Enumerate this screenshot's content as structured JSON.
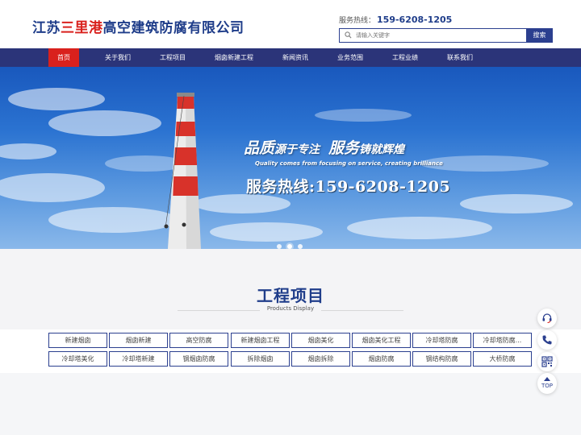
{
  "header": {
    "company_part1": "江苏",
    "company_highlight": "三里港",
    "company_part2": "高空建筑防腐有限公司",
    "hotline_label": "服务热线：",
    "hotline_number": "159-6208-1205",
    "search_placeholder": "请输入关键字",
    "search_button": "搜索"
  },
  "nav": {
    "items": [
      {
        "label": "首页",
        "active": true
      },
      {
        "label": "关于我们"
      },
      {
        "label": "工程项目"
      },
      {
        "label": "烟囱新建工程"
      },
      {
        "label": "新闻资讯"
      },
      {
        "label": "业务范围"
      },
      {
        "label": "工程业绩"
      },
      {
        "label": "联系我们"
      }
    ]
  },
  "banner": {
    "slogan_1": "品质",
    "slogan_2": "源于专注",
    "slogan_3": "服务",
    "slogan_4": "铸就辉煌",
    "slogan_en": "Quality comes from focusing on service, creating brilliance",
    "hotline": "服务热线:159-6208-1205",
    "slides": 3,
    "active_slide": 2
  },
  "products": {
    "title": "工程项目",
    "subtitle": "Products Display",
    "tags": [
      "新建烟囱",
      "烟囱新建",
      "高空防腐",
      "新建烟囱工程",
      "烟囱美化",
      "烟囱美化工程",
      "冷却塔防腐",
      "冷却塔防腐...",
      "冷却塔美化",
      "冷却塔新建",
      "钢烟囱防腐",
      "拆除烟囱",
      "烟囱拆除",
      "烟囱防腐",
      "钢结构防腐",
      "大桥防腐"
    ]
  },
  "sidebar": {
    "top_label": "TOP"
  },
  "colors": {
    "brand_blue": "#1f3d8a",
    "nav_bg": "#2b3479",
    "accent_red": "#d9211d"
  }
}
